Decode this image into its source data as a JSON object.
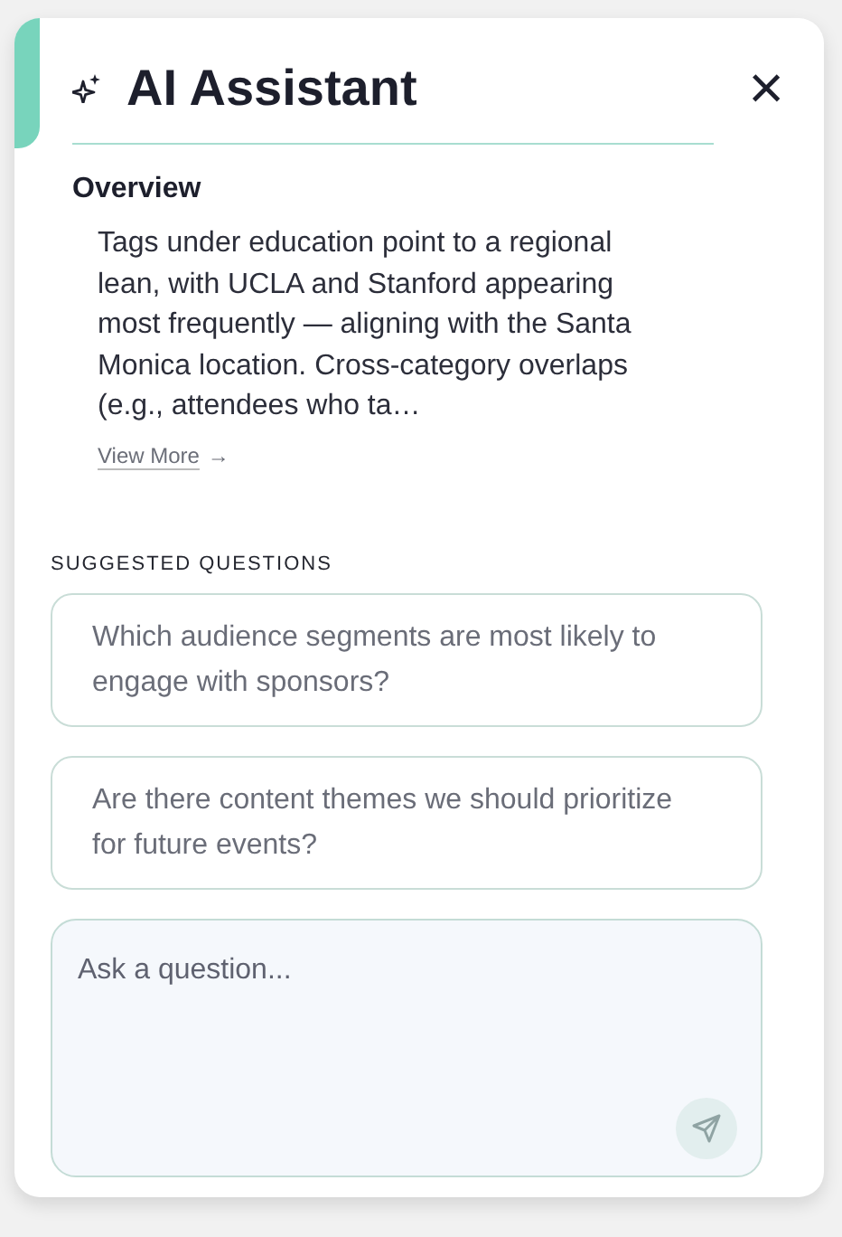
{
  "panel": {
    "title": "AI Assistant",
    "close_label": "×"
  },
  "overview": {
    "heading": "Overview",
    "text": "Tags under education point to a regional lean, with UCLA and Stanford appearing most frequently — aligning with the Santa Monica location. Cross-category overlaps (e.g., attendees who ta…",
    "link": "View More",
    "link_arrow": "→"
  },
  "suggested": {
    "label": "SUGGESTED QUESTIONS",
    "questions": [
      {
        "text": "Which audience segments are most likely to engage with sponsors?"
      },
      {
        "text": "Are there content themes we should prioritize for future events?"
      }
    ]
  },
  "input": {
    "placeholder": "Ask a question...",
    "send_disabled": true
  }
}
